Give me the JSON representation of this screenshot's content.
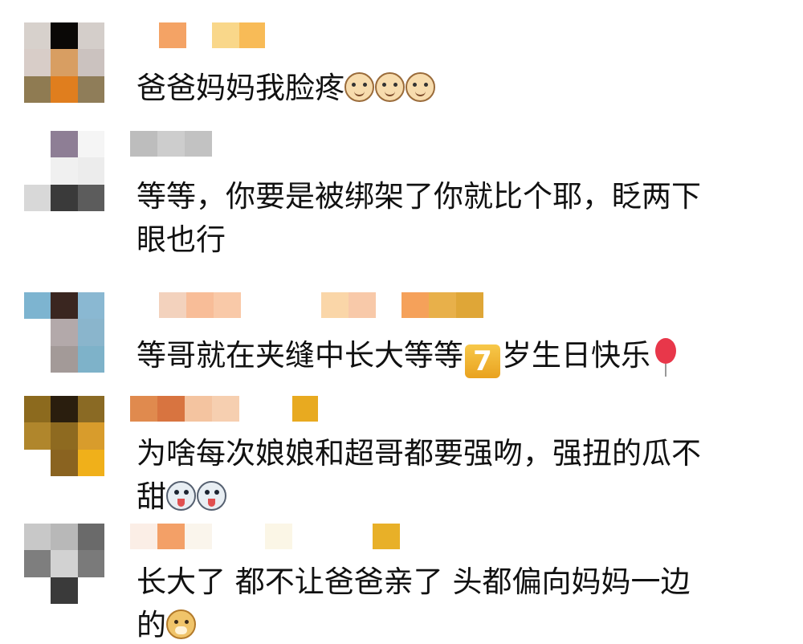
{
  "comments": [
    {
      "text": "爸爸妈妈我脸疼",
      "emoji": [
        "cat-face-icon",
        "cat-face-icon",
        "cat-face-icon"
      ]
    },
    {
      "line1": "等等，你要是被绑架了你就比个耶，眨两下",
      "line2": "眼也行"
    },
    {
      "text_before": "等哥就在夹缝中长大等等",
      "badge": "7",
      "text_after": "岁生日快乐",
      "emoji": [
        "balloon-icon"
      ]
    },
    {
      "line1": "为啥每次娘娘和超哥都要强吻，强扭的瓜不",
      "line2": "甜",
      "emoji": [
        "husky-icon",
        "husky-icon"
      ]
    },
    {
      "line1": "长大了 都不让爸爸亲了 头都偏向妈妈一边",
      "line2": "的",
      "emoji": [
        "doge-icon"
      ]
    }
  ],
  "colors": {
    "text": "#111111",
    "background": "#ffffff",
    "badge": "#f0b030",
    "balloon": "#e8374a"
  }
}
